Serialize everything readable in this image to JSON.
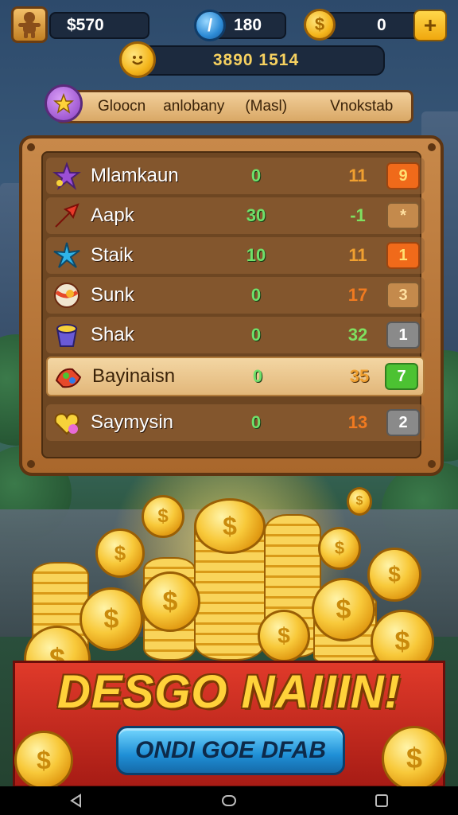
{
  "hud": {
    "money": "$570",
    "gems": "180",
    "coins": "0",
    "plus_label": "+",
    "gem_symbol": "/",
    "coin_symbol": "$"
  },
  "score": {
    "value": "3890 1514"
  },
  "tabs": [
    "Gloocn",
    "anlobany",
    "(Masl)",
    "Vnokstab"
  ],
  "leaderboard": [
    {
      "name": "Mlamkaun",
      "score": "0",
      "value": "11",
      "rank": "9",
      "icon": "purple-star-icon",
      "value_color": "#f0a030",
      "rank_bg": "#f06a1a",
      "rank_fg": "#ffe070",
      "highlight": false
    },
    {
      "name": "Aapk",
      "score": "30",
      "value": "-1",
      "rank": "*",
      "icon": "red-arrow-icon",
      "value_color": "#7fe060",
      "rank_bg": "#c48a4c",
      "rank_fg": "#ffe0a0",
      "highlight": false
    },
    {
      "name": "Staik",
      "score": "10",
      "value": "11",
      "rank": "1",
      "icon": "blue-star-icon",
      "value_color": "#f0a030",
      "rank_bg": "#f06a1a",
      "rank_fg": "#ffe070",
      "highlight": false
    },
    {
      "name": "Sunk",
      "score": "0",
      "value": "17",
      "rank": "3",
      "icon": "striped-ball-icon",
      "value_color": "#f07a20",
      "rank_bg": "#c48a4c",
      "rank_fg": "#ffe0a0",
      "highlight": false
    },
    {
      "name": "Shak",
      "score": "0",
      "value": "32",
      "rank": "1",
      "icon": "purple-cup-icon",
      "value_color": "#7fe060",
      "rank_bg": "#8a8a8a",
      "rank_fg": "#ffffff",
      "highlight": false
    },
    {
      "name": "Bayinaisn",
      "score": "0",
      "value": "35",
      "rank": "7",
      "icon": "candy-bag-icon",
      "value_color": "#f0a030",
      "rank_bg": "#4cc232",
      "rank_fg": "#ffffff",
      "highlight": true
    },
    {
      "name": "Saymysin",
      "score": "0",
      "value": "13",
      "rank": "2",
      "icon": "yellow-heart-icon",
      "value_color": "#f07a20",
      "rank_bg": "#8a8a8a",
      "rank_fg": "#ffffff",
      "highlight": false
    }
  ],
  "banner": {
    "title": "DESGO NAIIIN!",
    "cta_label": "ONDI GOE DFAB"
  },
  "coin_glyph": "$"
}
